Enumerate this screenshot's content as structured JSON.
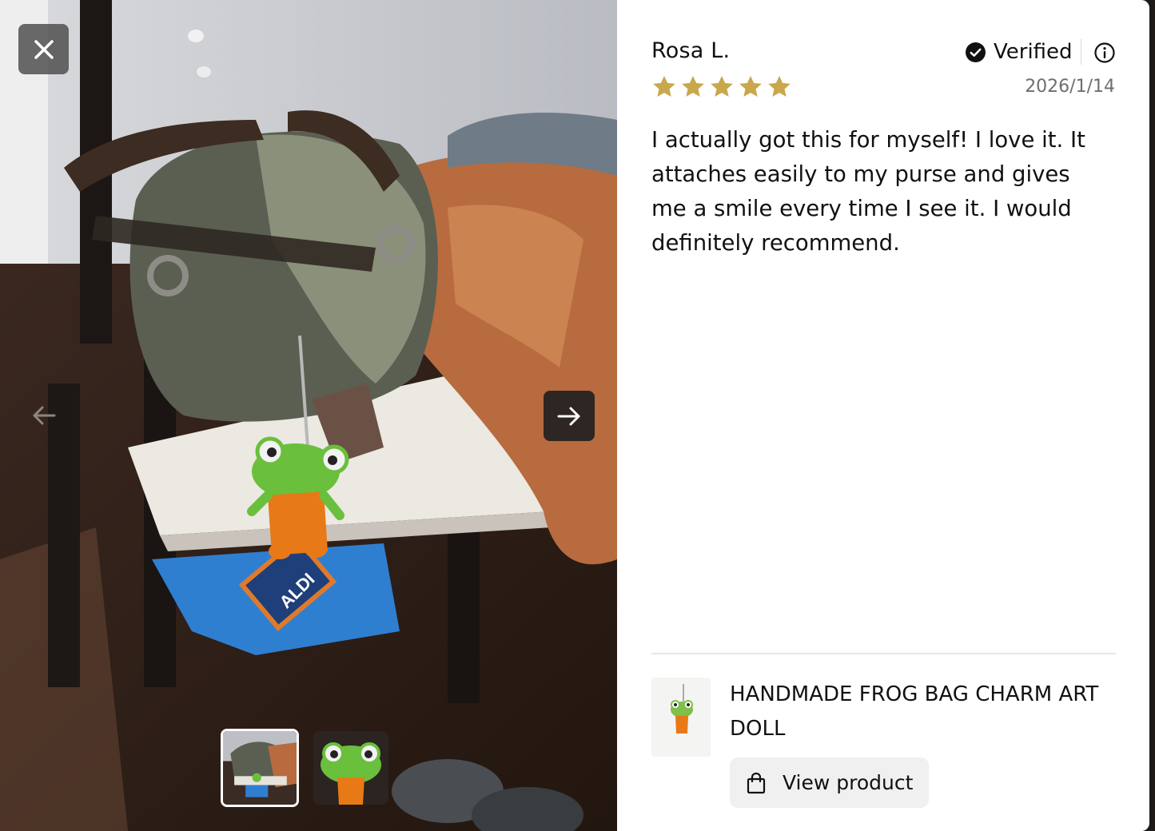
{
  "review": {
    "reviewer_name": "Rosa L.",
    "verified_label": "Verified",
    "rating": 5,
    "max_rating": 5,
    "date": "2026/1/14",
    "body": "I actually got this for myself! I love it. It attaches easily to my purse and gives me a smile every time I see it. I would definitely recommend."
  },
  "product": {
    "title": "HANDMADE FROG BAG CHARM ART DOLL",
    "view_button_label": "View product"
  },
  "media": {
    "photo_count": 2,
    "active_index": 0,
    "bag_print": "ALDI",
    "star_color": "#C8A84B",
    "icons": {
      "close": "close-icon",
      "prev": "arrow-left-icon",
      "next": "arrow-right-icon",
      "verified": "check-circle-icon",
      "info": "info-icon",
      "bag": "shopping-bag-icon"
    }
  }
}
